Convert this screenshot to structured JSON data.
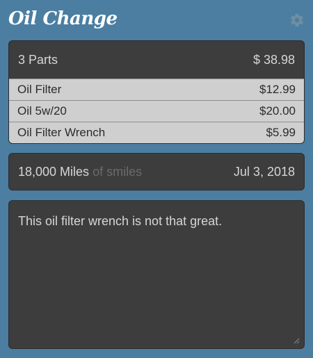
{
  "header": {
    "title": "Oil Change",
    "settings_icon": "gear-icon"
  },
  "parts": {
    "summary_label": "3 Parts",
    "summary_total": "$ 38.98",
    "items": [
      {
        "name": "Oil Filter",
        "price": "$12.99"
      },
      {
        "name": "Oil 5w/20",
        "price": "$20.00"
      },
      {
        "name": "Oil Filter Wrench",
        "price": "$5.99"
      }
    ]
  },
  "mileage": {
    "miles": "18,000 Miles",
    "suffix": "of smiles",
    "date": "Jul 3, 2018"
  },
  "notes": {
    "text": "This oil filter wrench is not that great."
  },
  "colors": {
    "background": "#4b7ea1",
    "card": "#3d3d3d",
    "list_bg": "#cfcfcf"
  }
}
